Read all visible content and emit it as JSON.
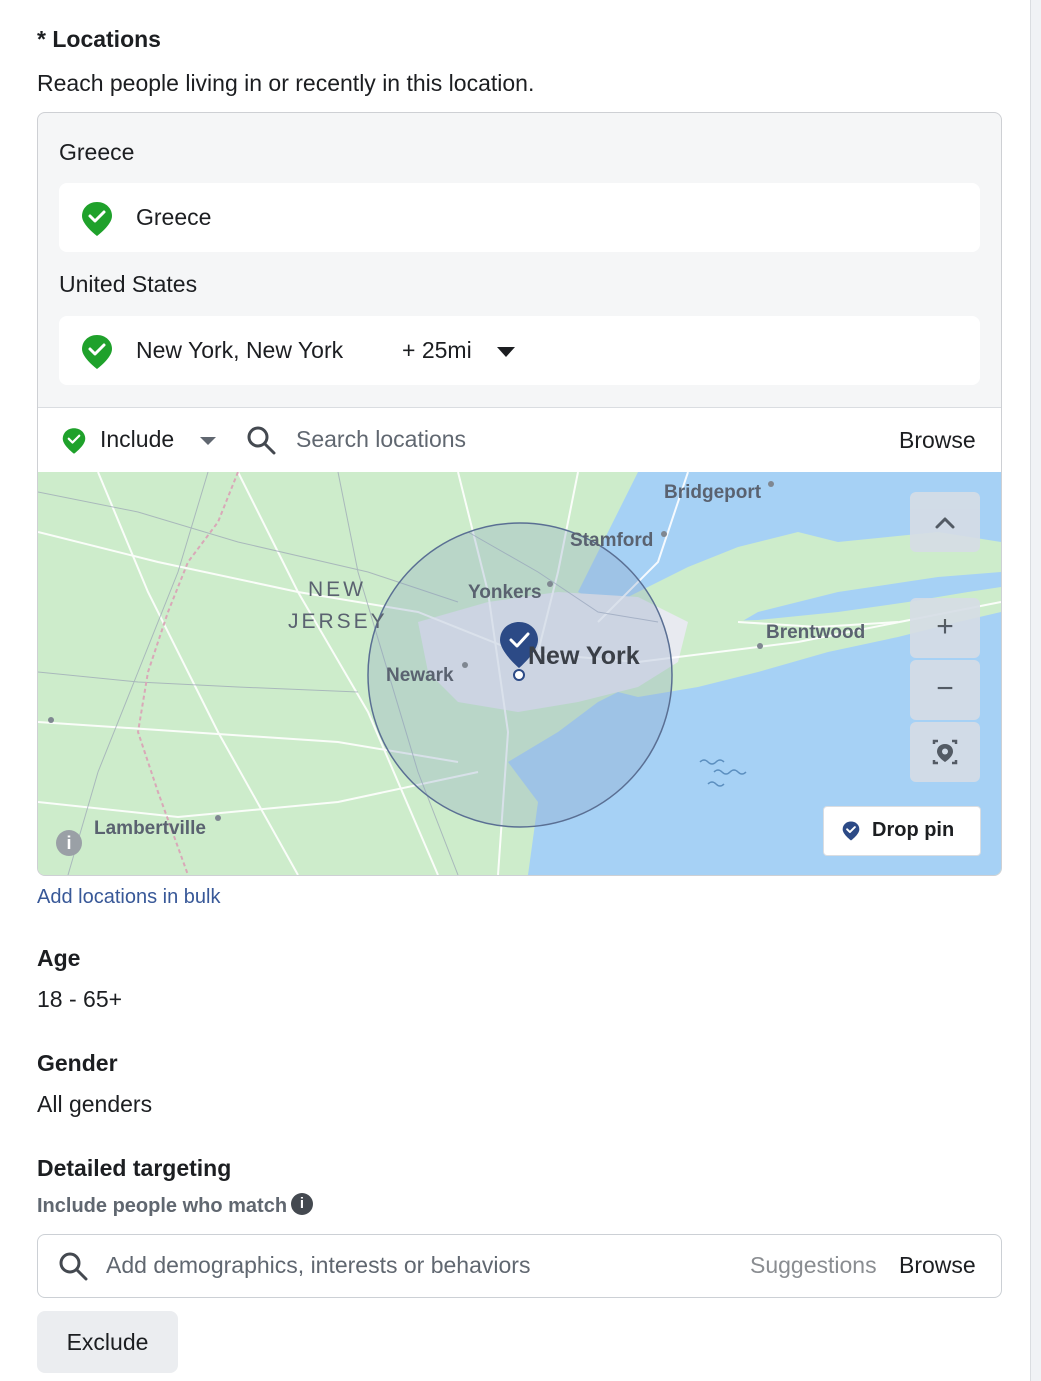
{
  "locations": {
    "title": "* Locations",
    "description": "Reach people living in or recently in this location.",
    "groups": [
      {
        "country": "Greece",
        "items": [
          {
            "name": "Greece"
          }
        ]
      },
      {
        "country": "United States",
        "items": [
          {
            "name": "New York, New York",
            "radius": "+ 25mi"
          }
        ]
      }
    ],
    "include_label": "Include",
    "search_placeholder": "Search locations",
    "browse_label": "Browse",
    "map": {
      "labels": {
        "bridgeport": "Bridgeport",
        "stamford": "Stamford",
        "yonkers": "Yonkers",
        "new_jersey_1": "NEW",
        "new_jersey_2": "JERSEY",
        "brentwood": "Brentwood",
        "newark": "Newark",
        "new_york": "New York",
        "lambertville": "Lambertville"
      },
      "drop_pin_label": "Drop pin",
      "zoom_in": "+",
      "zoom_out": "−"
    },
    "bulk_link": "Add locations in bulk"
  },
  "age": {
    "title": "Age",
    "value": "18 - 65+"
  },
  "gender": {
    "title": "Gender",
    "value": "All genders"
  },
  "detailed_targeting": {
    "title": "Detailed targeting",
    "subtitle": "Include people who match",
    "placeholder": "Add demographics, interests or behaviors",
    "suggestions_label": "Suggestions",
    "browse_label": "Browse",
    "exclude_label": "Exclude"
  },
  "colors": {
    "accent_green": "#1fa12b",
    "pin_navy": "#2c4a86",
    "link": "#385898",
    "water": "#a6d1f5"
  }
}
